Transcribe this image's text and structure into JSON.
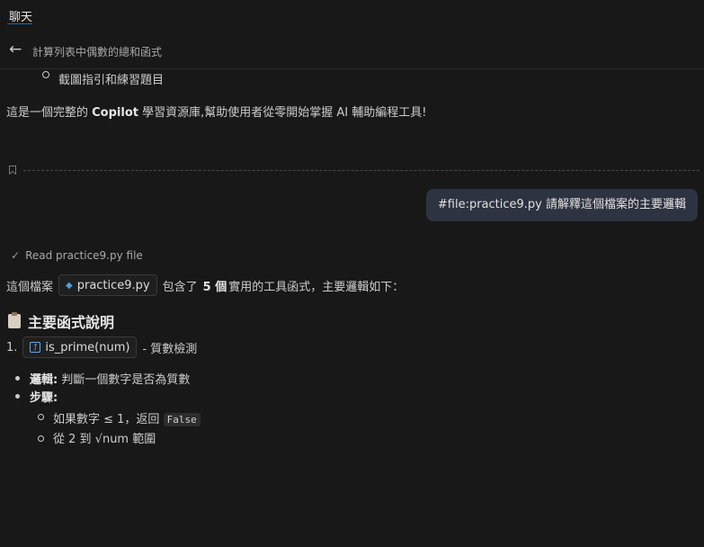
{
  "tab": {
    "label": "聊天"
  },
  "header": {
    "title": "計算列表中偶數的總和函式"
  },
  "partial_list_item": "截圖指引和練習題目",
  "summary": {
    "prefix": "這是一個完整的 ",
    "bold": "Copilot",
    "suffix": " 學習資源庫,幫助使用者從零開始掌握 AI 輔助編程工具!"
  },
  "user_message": "#file:practice9.py 請解釋這個檔案的主要邏輯",
  "read_status": "Read practice9.py file",
  "file_line": {
    "prefix": "這個檔案",
    "file_chip": "practice9.py",
    "middle": "包含了",
    "count": "5 個",
    "suffix": "實用的工具函式，主要邏輯如下："
  },
  "section_title": "主要函式說明",
  "item1": {
    "number": "1.",
    "chip": "is_prime(num)",
    "desc": "- 質數檢測"
  },
  "bullets": {
    "logic_label": "邏輯:",
    "logic_text": " 判斷一個數字是否為質數",
    "steps_label": "步驟:"
  },
  "sub_steps": {
    "step1_text": "如果數字 ≤ 1，返回",
    "step1_code": "False",
    "step2_text": "從 2 到 √num 範圍"
  }
}
